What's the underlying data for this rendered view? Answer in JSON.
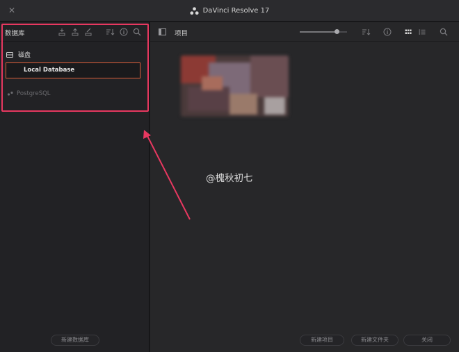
{
  "app": {
    "title": "DaVinci Resolve 17"
  },
  "left_panel": {
    "toolbar_label": "数据库",
    "section_title": "磁盘",
    "databases": [
      {
        "name": "Local Database",
        "selected": true
      },
      {
        "name": "PostgreSQL",
        "selected": false
      }
    ],
    "new_database_button": "新建数据库"
  },
  "right_panel": {
    "toolbar_label": "项目",
    "buttons": {
      "new_project": "新建项目",
      "new_folder": "新建文件夹",
      "close": "关闭"
    }
  },
  "watermark": "@槐秋初七",
  "colors": {
    "highlight": "#e83860",
    "selection_border": "#e0603a"
  },
  "icons": [
    "close-icon",
    "davinci-logo-icon",
    "database-add-icon",
    "database-upload-icon",
    "database-edit-icon",
    "sort-icon",
    "info-icon",
    "search-icon",
    "disk-icon",
    "sidebar-toggle-icon",
    "grid-view-icon",
    "list-view-icon"
  ]
}
